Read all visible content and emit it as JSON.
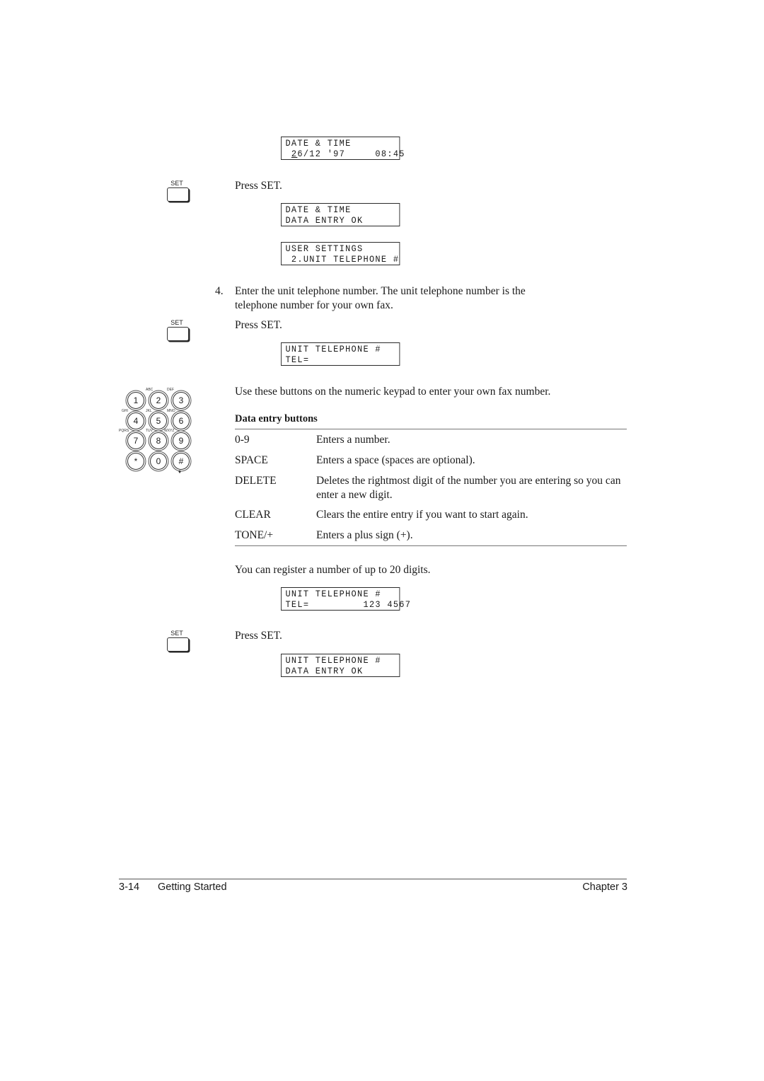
{
  "displays": [
    {
      "line1": "DATE & TIME",
      "line2_underlined": "2",
      "line2_rest": "6/12 '97     08:45"
    },
    {
      "line1": "DATE & TIME",
      "line2": "DATA ENTRY OK"
    },
    {
      "line1": "USER SETTINGS",
      "line2": " 2.UNIT TELEPHONE #"
    },
    {
      "line1": "UNIT TELEPHONE #",
      "line2": "TEL="
    },
    {
      "line1": "UNIT TELEPHONE #",
      "line2": "TEL=         123 4567"
    },
    {
      "line1": "UNIT TELEPHONE #",
      "line2": "DATA ENTRY OK"
    }
  ],
  "set_key_label": "SET",
  "press_set": "Press SET.",
  "step4": {
    "number": "4.",
    "line1": "Enter the unit telephone number. The unit telephone number is the",
    "line2": "telephone number for your own fax."
  },
  "keypad_intro": "Use these buttons on the numeric keypad to enter your own fax number.",
  "keypad": {
    "keys": [
      "1",
      "2",
      "3",
      "4",
      "5",
      "6",
      "7",
      "8",
      "9",
      "*",
      "0",
      "#"
    ],
    "letters": [
      "",
      "ABC",
      "DEF",
      "GHI",
      "JKL",
      "MNO",
      "PQRS",
      "TUV",
      "WXYZ"
    ],
    "tone_mark": "♦"
  },
  "table": {
    "title": "Data entry buttons",
    "rows": [
      {
        "key": "0-9",
        "desc": "Enters a number."
      },
      {
        "key": "SPACE",
        "desc": "Enters a space (spaces are optional)."
      },
      {
        "key": "DELETE",
        "desc": "Deletes the rightmost digit of the number you are entering so you can enter a new digit."
      },
      {
        "key": "CLEAR",
        "desc": "Clears the entire entry if you want to start again."
      },
      {
        "key": "TONE/+",
        "desc": "Enters a plus sign (+)."
      }
    ]
  },
  "register_note": "You can register a number of up to 20 digits.",
  "footer": {
    "page": "3-14",
    "section": "Getting Started",
    "chapter": "Chapter 3"
  }
}
